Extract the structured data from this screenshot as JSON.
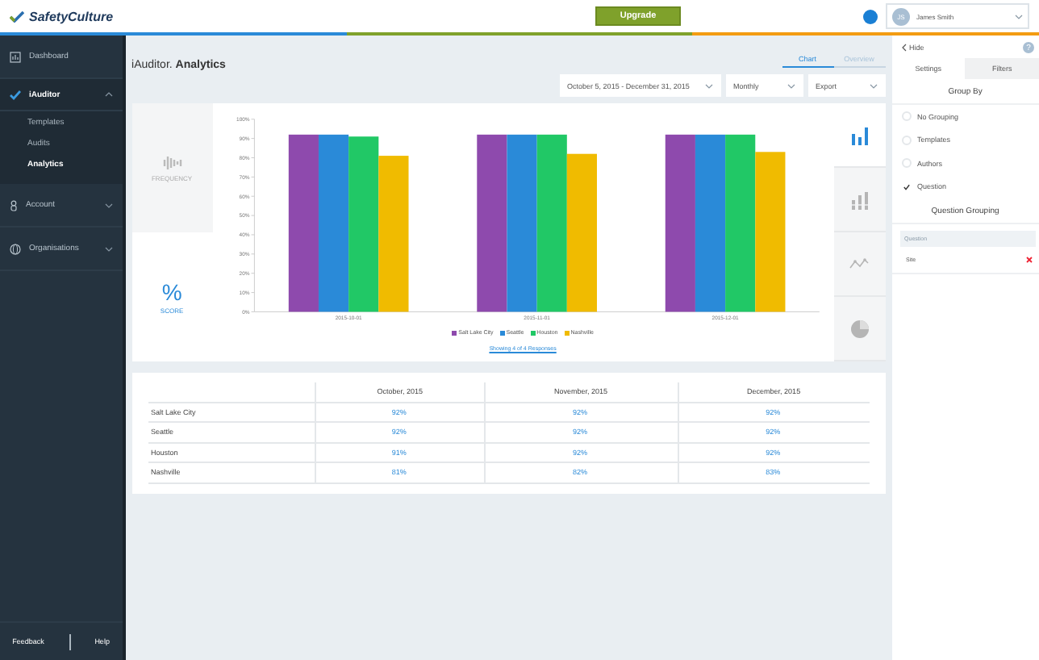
{
  "brand": {
    "name": "SafetyCulture"
  },
  "topbar": {
    "upgrade": "Upgrade",
    "user": {
      "initials": "JS",
      "name": "James Smith"
    }
  },
  "sidebar": {
    "items": [
      {
        "label": "Dashboard",
        "kind": "link"
      },
      {
        "label": "iAuditor",
        "kind": "section",
        "expanded": true,
        "children": [
          {
            "label": "Templates",
            "selected": false
          },
          {
            "label": "Audits",
            "selected": false
          },
          {
            "label": "Analytics",
            "selected": true
          }
        ]
      },
      {
        "label": "Account",
        "kind": "section",
        "expanded": false
      },
      {
        "label": "Organisations",
        "kind": "section",
        "expanded": false
      }
    ],
    "footer": [
      "Feedback",
      "Help"
    ]
  },
  "page": {
    "title": "iAuditor. **Analytics**",
    "views": [
      {
        "label": "Chart",
        "selected": true
      },
      {
        "label": "Overview",
        "selected": false
      }
    ],
    "date_range": "October 5, 2015 - December 31, 2015",
    "interval": "Monthly",
    "export": "Export",
    "metrics": [
      {
        "kind": "frequency",
        "label": "FREQUENCY",
        "selected": false
      },
      {
        "kind": "score",
        "label": "SCORE",
        "symbol": "%",
        "selected": true
      }
    ],
    "chart_types": [
      {
        "kind": "bar",
        "selected": true
      },
      {
        "kind": "stacked",
        "selected": false
      },
      {
        "kind": "line",
        "selected": false
      },
      {
        "kind": "pie",
        "selected": false
      }
    ],
    "chart_data": {
      "type": "bar",
      "categories": [
        "2015-10-01",
        "2015-11-01",
        "2015-12-01"
      ],
      "series": [
        {
          "name": "Salt Lake City",
          "color": "#8e4aad",
          "values": [
            92,
            92,
            92
          ]
        },
        {
          "name": "Seattle",
          "color": "#2a8ad8",
          "values": [
            92,
            92,
            92
          ]
        },
        {
          "name": "Houston",
          "color": "#21c866",
          "values": [
            91,
            92,
            92
          ]
        },
        {
          "name": "Nashville",
          "color": "#f0bb00",
          "values": [
            81,
            82,
            83
          ]
        }
      ],
      "ylim": [
        0,
        100
      ],
      "yticks": [
        {
          "value": 0,
          "label": "0%"
        },
        {
          "value": 10,
          "label": "10%"
        },
        {
          "value": 20,
          "label": "20%"
        },
        {
          "value": 30,
          "label": "30%"
        },
        {
          "value": 40,
          "label": "40%"
        },
        {
          "value": 50,
          "label": "50%"
        },
        {
          "value": 60,
          "label": "60%"
        },
        {
          "value": 70,
          "label": "70%"
        },
        {
          "value": 80,
          "label": "80%"
        },
        {
          "value": 90,
          "label": "90%"
        },
        {
          "value": 100,
          "label": "100%"
        }
      ]
    },
    "responses_link": "Showing 4 of 4 Responses",
    "table": {
      "columns": [
        "October, 2015",
        "November, 2015",
        "December, 2015"
      ],
      "rows": [
        {
          "label": "Salt Lake City",
          "cells": [
            "92%",
            "92%",
            "92%"
          ]
        },
        {
          "label": "Seattle",
          "cells": [
            "92%",
            "92%",
            "92%"
          ]
        },
        {
          "label": "Houston",
          "cells": [
            "91%",
            "92%",
            "92%"
          ]
        },
        {
          "label": "Nashville",
          "cells": [
            "81%",
            "82%",
            "83%"
          ]
        }
      ]
    }
  },
  "panel": {
    "hide": "Hide",
    "help": "?",
    "tabs": [
      {
        "label": "Settings",
        "selected": true
      },
      {
        "label": "Filters",
        "selected": false
      }
    ],
    "group_by_title": "Group By",
    "options": [
      {
        "label": "No Grouping",
        "checked": false
      },
      {
        "label": "Templates",
        "checked": false
      },
      {
        "label": "Authors",
        "checked": false
      },
      {
        "label": "Question",
        "checked": true
      }
    ],
    "question_grouping_title": "Question Grouping",
    "question_header": "Question",
    "items": [
      {
        "label": "Site"
      }
    ]
  }
}
